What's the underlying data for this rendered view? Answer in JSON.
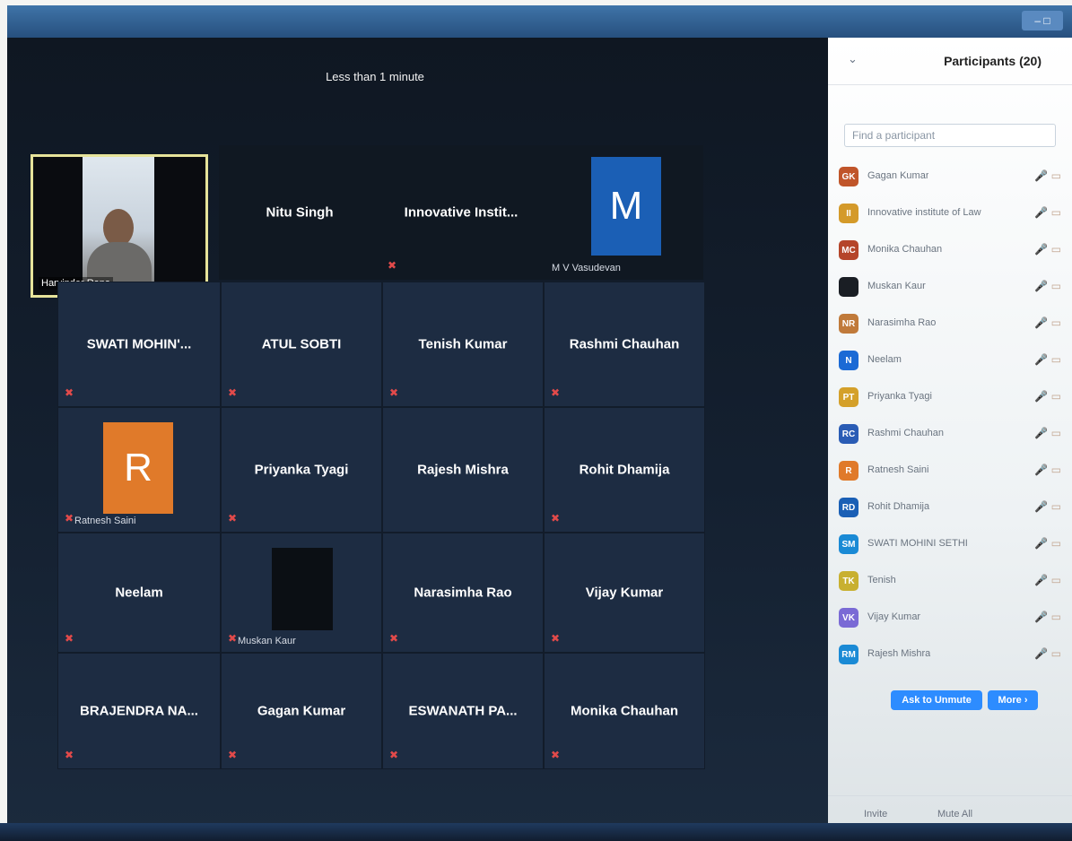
{
  "window": {
    "controls": "– □"
  },
  "meeting": {
    "timer": "Less than 1 minute"
  },
  "video": {
    "name": "Harvinder Rana"
  },
  "tiles": {
    "nitu": "Nitu Singh",
    "innovative": "Innovative Instit...",
    "mv_initial": "M",
    "mv_name": "M V Vasudevan",
    "swati": "SWATI MOHIN'...",
    "atul": "ATUL SOBTI",
    "tenish": "Tenish Kumar",
    "rashmi": "Rashmi Chauhan",
    "ratnesh_initial": "R",
    "ratnesh_name": "Ratnesh Saini",
    "priyanka": "Priyanka Tyagi",
    "rajesh": "Rajesh Mishra",
    "rohit": "Rohit Dhamija",
    "neelam": "Neelam",
    "muskan_name": "Muskan Kaur",
    "narasimha": "Narasimha Rao",
    "vijay": "Vijay Kumar",
    "brajendra": "BRAJENDRA NA...",
    "gagan": "Gagan Kumar",
    "eswanath": "ESWANATH PA...",
    "monika": "Monika Chauhan"
  },
  "colors": {
    "mv_avatar": "#1b5fb5",
    "ratnesh_avatar": "#e07a2a",
    "zoom_blue": "#2d8cff"
  },
  "panel": {
    "title": "Participants (20)",
    "search_placeholder": "Find a participant",
    "participants": [
      {
        "initials": "GK",
        "name": "Gagan Kumar",
        "color": "#c0552a"
      },
      {
        "initials": "II",
        "name": "Innovative institute of Law",
        "color": "#d49a2a"
      },
      {
        "initials": "MC",
        "name": "Monika Chauhan",
        "color": "#b5452a"
      },
      {
        "initials": "",
        "name": "Muskan Kaur",
        "color": "#1a1e24"
      },
      {
        "initials": "NR",
        "name": "Narasimha Rao",
        "color": "#c07a3a"
      },
      {
        "initials": "N",
        "name": "Neelam",
        "color": "#1b6ad5"
      },
      {
        "initials": "PT",
        "name": "Priyanka Tyagi",
        "color": "#d4a02a"
      },
      {
        "initials": "RC",
        "name": "Rashmi Chauhan",
        "color": "#2a5cb5"
      },
      {
        "initials": "R",
        "name": "Ratnesh Saini",
        "color": "#e07a2a"
      },
      {
        "initials": "RD",
        "name": "Rohit Dhamija",
        "color": "#1a5fb5"
      },
      {
        "initials": "SM",
        "name": "SWATI MOHINI SETHI",
        "color": "#1a8ad5"
      },
      {
        "initials": "TK",
        "name": "Tenish",
        "color": "#c8b030"
      },
      {
        "initials": "VK",
        "name": "Vijay Kumar",
        "color": "#7a6ad5"
      },
      {
        "initials": "RM",
        "name": "Rajesh Mishra",
        "color": "#1a8ad5"
      }
    ],
    "mic_icons": "🎤 ▭",
    "ask_to_unmute": "Ask to Unmute",
    "more": "More ›",
    "invite": "Invite",
    "mute_all": "Mute All"
  }
}
